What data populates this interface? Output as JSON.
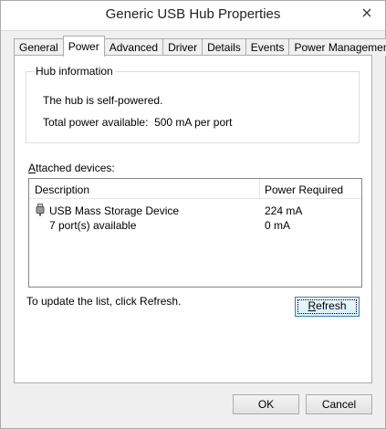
{
  "window": {
    "title": "Generic USB Hub Properties"
  },
  "tabs": [
    {
      "label": "General"
    },
    {
      "label": "Power"
    },
    {
      "label": "Advanced"
    },
    {
      "label": "Driver"
    },
    {
      "label": "Details"
    },
    {
      "label": "Events"
    },
    {
      "label": "Power Management"
    }
  ],
  "active_tab": "Power",
  "hub_info": {
    "label": "Hub information",
    "self_powered": "The hub is self-powered.",
    "total_power_label": "Total power available:",
    "total_power_value": "500 mA per port"
  },
  "attached": {
    "label": "Attached devices:",
    "columns": {
      "description": "Description",
      "power": "Power Required"
    },
    "rows": [
      {
        "description": "USB Mass Storage Device",
        "power": "224 mA",
        "icon": "usb-plug-icon"
      },
      {
        "description": "7 port(s) available",
        "power": "0 mA"
      }
    ]
  },
  "refresh_note": "To update the list, click Refresh.",
  "buttons": {
    "refresh": "Refresh",
    "ok": "OK",
    "cancel": "Cancel"
  },
  "colors": {
    "window_bg": "#f0f0f0",
    "panel_bg": "#ffffff",
    "focus_border": "#3c7fb1"
  }
}
